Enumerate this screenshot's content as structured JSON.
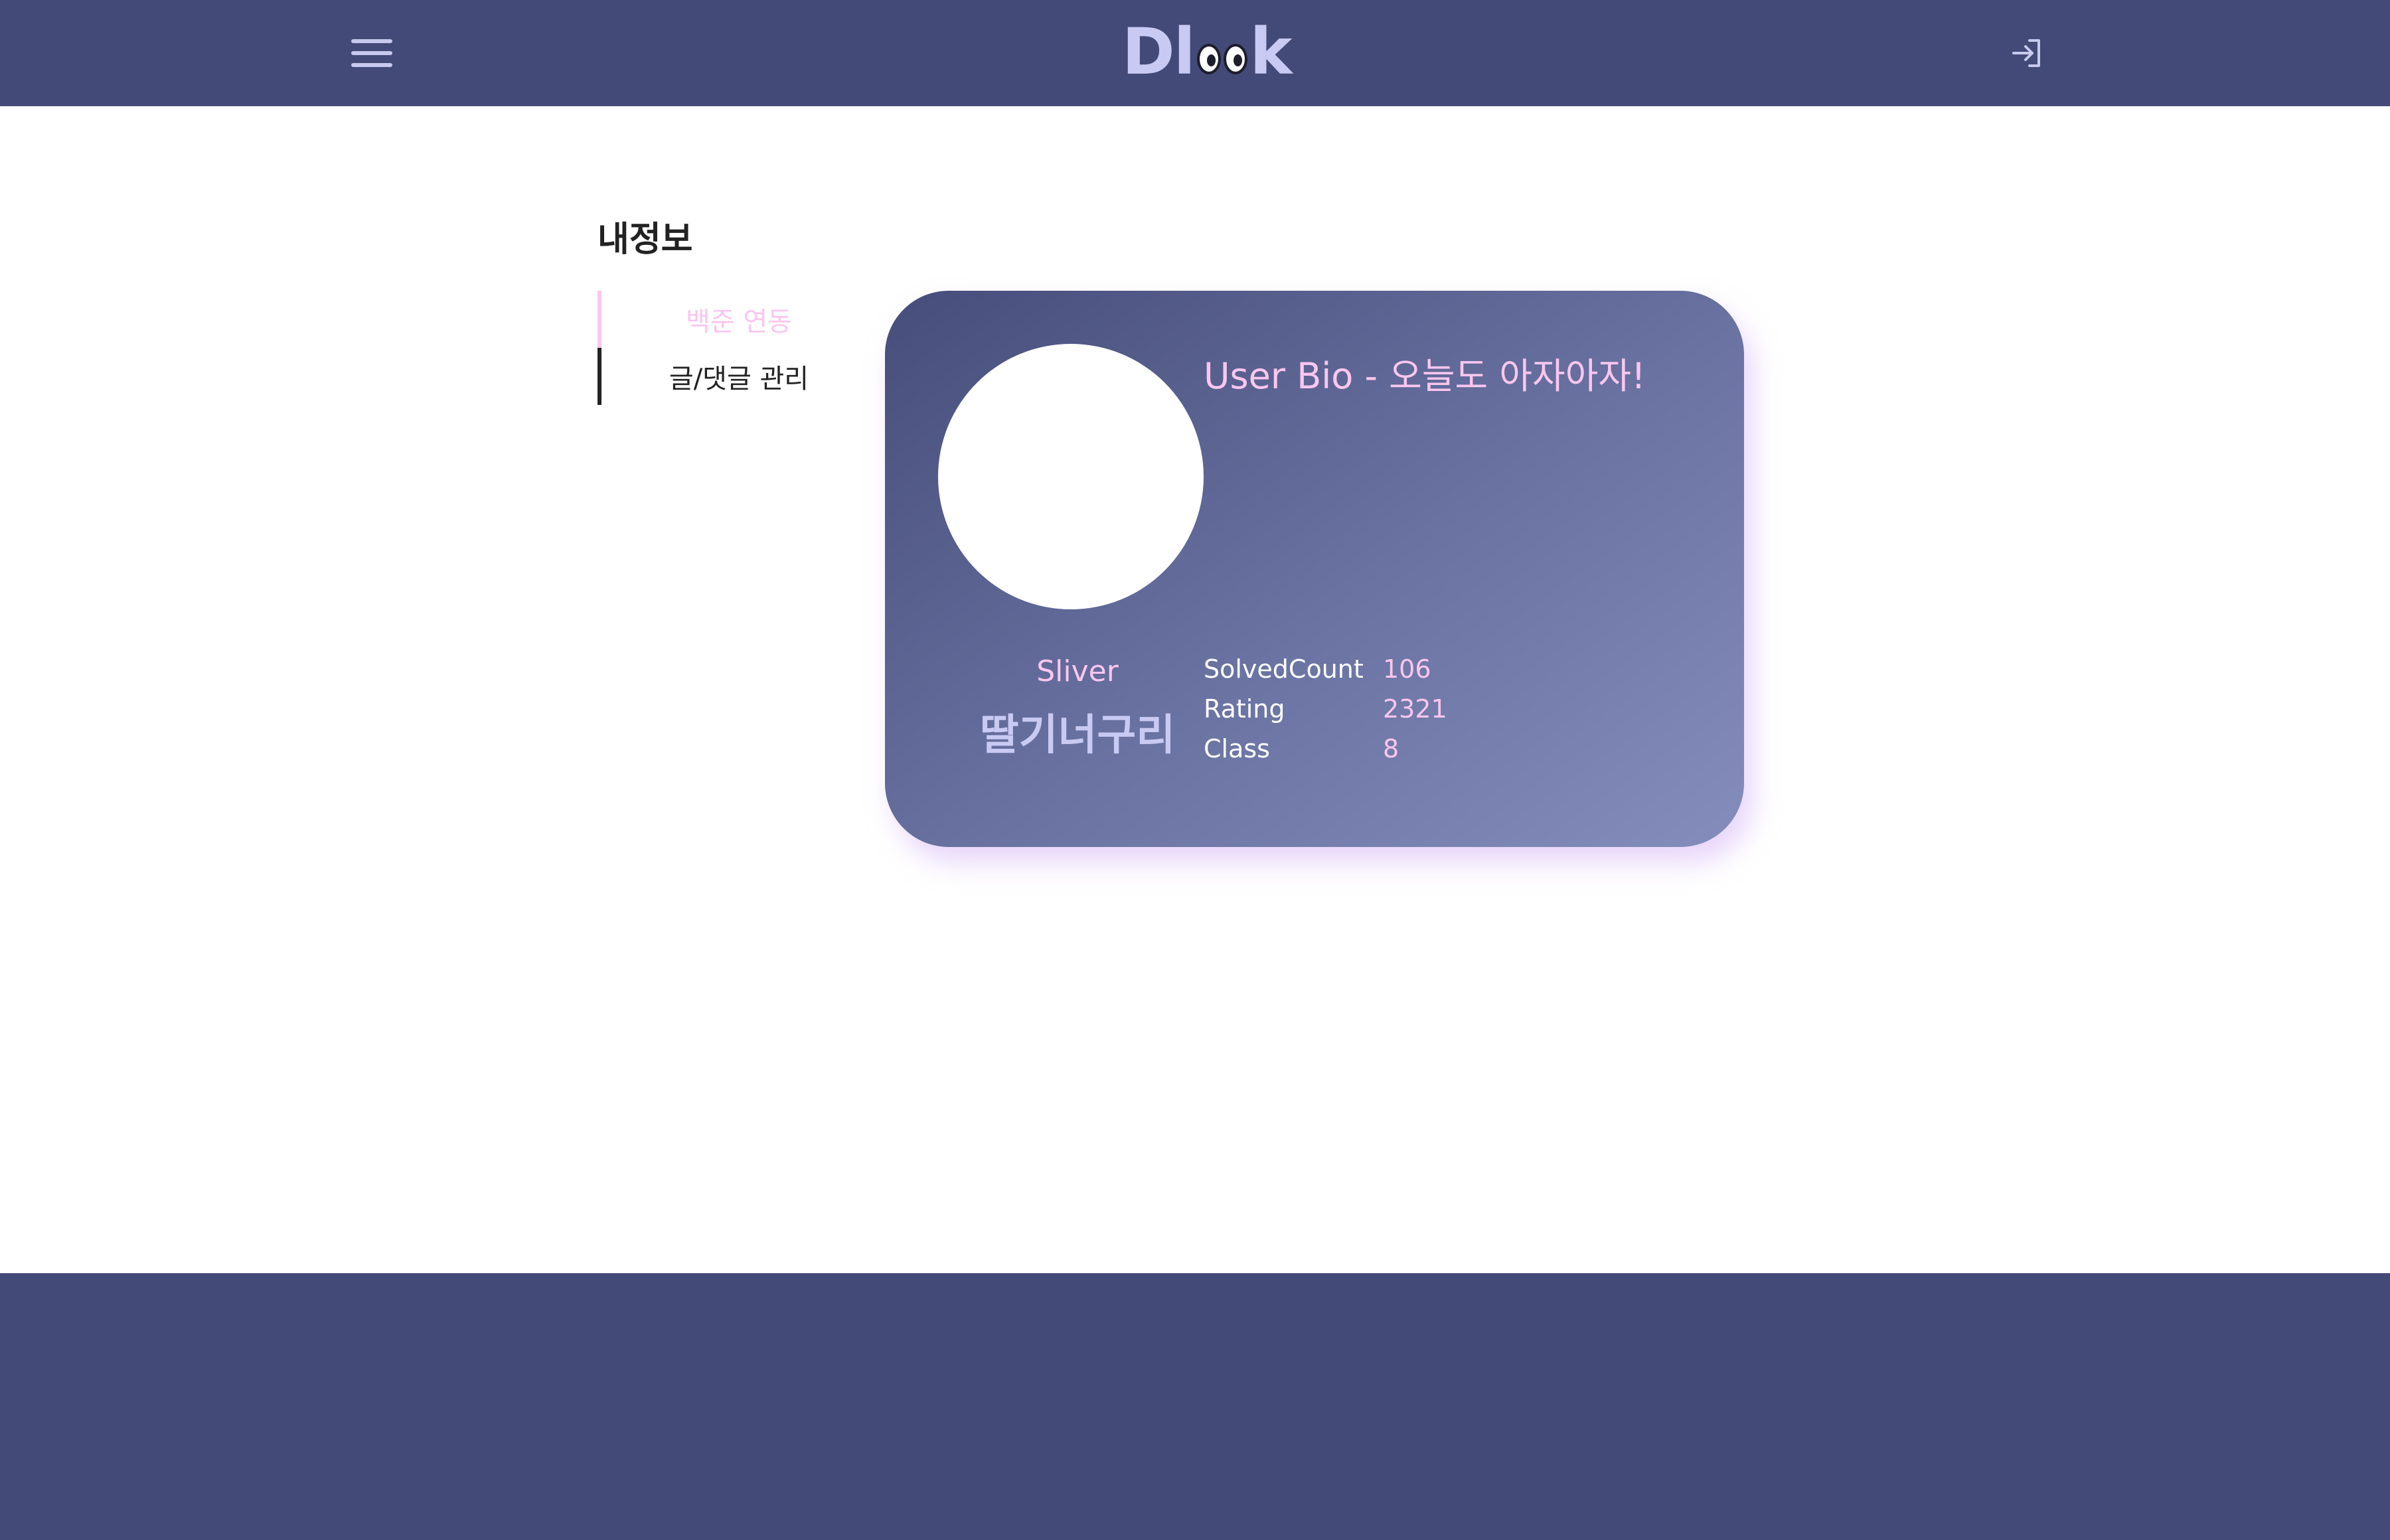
{
  "colors": {
    "header_bg": "#434a77",
    "accent_pink": "#fac6ef",
    "logo_lavender": "#c8caf3",
    "card_gradient_start": "#464d7a",
    "card_gradient_end": "#848dbb",
    "footer_bg": "#434a77"
  },
  "header": {
    "menu_icon": "hamburger-menu-icon",
    "logo": {
      "text_start": "Dl",
      "text_end": "k",
      "eyes_icon": "googly-eyes-icon"
    },
    "login_icon": "login-arrow-icon"
  },
  "sidebar": {
    "title": "내정보",
    "items": [
      {
        "label": "백준 연동",
        "active": true
      },
      {
        "label": "글/댓글 관리",
        "active": false
      }
    ]
  },
  "profile_card": {
    "bio": "User Bio - 오늘도 아자아자!",
    "tier": "Sliver",
    "nickname": "딸기너구리",
    "stats": [
      {
        "label": "SolvedCount",
        "value": "106"
      },
      {
        "label": "Rating",
        "value": "2321"
      },
      {
        "label": "Class",
        "value": "8"
      }
    ]
  }
}
